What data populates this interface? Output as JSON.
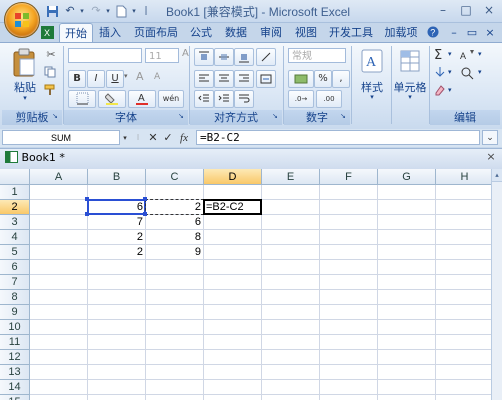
{
  "app": {
    "title": "Book1  [兼容模式] - Microsoft Excel"
  },
  "quick_access": {
    "save_icon": "save-icon",
    "undo_icon": "undo-icon",
    "redo_icon": "redo-icon"
  },
  "window_buttons": {
    "minimize": "–",
    "maximize": "□",
    "close": "×"
  },
  "tabs": [
    {
      "label": "开始",
      "active": true
    },
    {
      "label": "插入"
    },
    {
      "label": "页面布局"
    },
    {
      "label": "公式"
    },
    {
      "label": "数据"
    },
    {
      "label": "审阅"
    },
    {
      "label": "视图"
    },
    {
      "label": "开发工具"
    },
    {
      "label": "加载项"
    }
  ],
  "ribbon": {
    "clipboard": {
      "paste_label": "粘贴",
      "group_label": "剪贴板"
    },
    "font": {
      "font_name": "",
      "font_size": "11",
      "bold": "B",
      "italic": "I",
      "underline": "U",
      "phonetic": "wén",
      "group_label": "字体"
    },
    "alignment": {
      "group_label": "对齐方式"
    },
    "number": {
      "format": "常规",
      "percent": "%",
      "comma": ",",
      "group_label": "数字"
    },
    "styles": {
      "label": "样式"
    },
    "cells": {
      "label": "单元格"
    },
    "editing": {
      "group_label": "编辑",
      "sum_icon": "Σ"
    }
  },
  "formula_bar": {
    "name_box": "SUM",
    "cancel": "✕",
    "enter": "✓",
    "fx": "fx",
    "formula": "=B2-C2"
  },
  "workbook": {
    "title": "Book1 *"
  },
  "sheet": {
    "columns": [
      "A",
      "B",
      "C",
      "D",
      "E",
      "F",
      "G",
      "H"
    ],
    "rows": [
      "1",
      "2",
      "3",
      "4",
      "5",
      "6",
      "7",
      "8",
      "9",
      "10",
      "11",
      "12",
      "13",
      "14",
      "15"
    ],
    "selected_column": "D",
    "selected_row": "2",
    "cells": {
      "B2": "6",
      "C2": "2",
      "D2": "=B2-C2",
      "B3": "7",
      "C3": "6",
      "B4": "2",
      "C4": "8",
      "B5": "2",
      "C5": "9"
    }
  }
}
